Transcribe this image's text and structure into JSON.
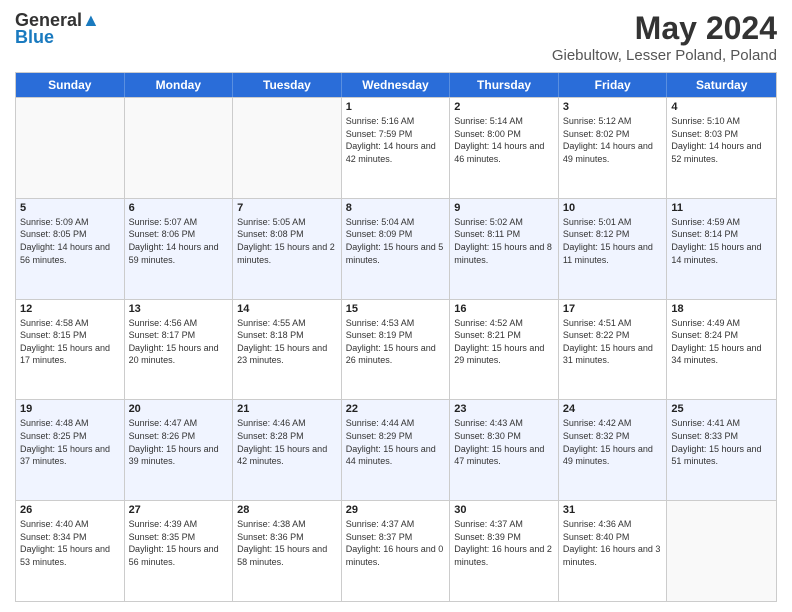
{
  "header": {
    "logo_general": "General",
    "logo_blue": "Blue",
    "title": "May 2024",
    "subtitle": "Giebultow, Lesser Poland, Poland"
  },
  "days_of_week": [
    "Sunday",
    "Monday",
    "Tuesday",
    "Wednesday",
    "Thursday",
    "Friday",
    "Saturday"
  ],
  "weeks": [
    [
      {
        "day": "",
        "sunrise": "",
        "sunset": "",
        "daylight": ""
      },
      {
        "day": "",
        "sunrise": "",
        "sunset": "",
        "daylight": ""
      },
      {
        "day": "",
        "sunrise": "",
        "sunset": "",
        "daylight": ""
      },
      {
        "day": "1",
        "sunrise": "Sunrise: 5:16 AM",
        "sunset": "Sunset: 7:59 PM",
        "daylight": "Daylight: 14 hours and 42 minutes."
      },
      {
        "day": "2",
        "sunrise": "Sunrise: 5:14 AM",
        "sunset": "Sunset: 8:00 PM",
        "daylight": "Daylight: 14 hours and 46 minutes."
      },
      {
        "day": "3",
        "sunrise": "Sunrise: 5:12 AM",
        "sunset": "Sunset: 8:02 PM",
        "daylight": "Daylight: 14 hours and 49 minutes."
      },
      {
        "day": "4",
        "sunrise": "Sunrise: 5:10 AM",
        "sunset": "Sunset: 8:03 PM",
        "daylight": "Daylight: 14 hours and 52 minutes."
      }
    ],
    [
      {
        "day": "5",
        "sunrise": "Sunrise: 5:09 AM",
        "sunset": "Sunset: 8:05 PM",
        "daylight": "Daylight: 14 hours and 56 minutes."
      },
      {
        "day": "6",
        "sunrise": "Sunrise: 5:07 AM",
        "sunset": "Sunset: 8:06 PM",
        "daylight": "Daylight: 14 hours and 59 minutes."
      },
      {
        "day": "7",
        "sunrise": "Sunrise: 5:05 AM",
        "sunset": "Sunset: 8:08 PM",
        "daylight": "Daylight: 15 hours and 2 minutes."
      },
      {
        "day": "8",
        "sunrise": "Sunrise: 5:04 AM",
        "sunset": "Sunset: 8:09 PM",
        "daylight": "Daylight: 15 hours and 5 minutes."
      },
      {
        "day": "9",
        "sunrise": "Sunrise: 5:02 AM",
        "sunset": "Sunset: 8:11 PM",
        "daylight": "Daylight: 15 hours and 8 minutes."
      },
      {
        "day": "10",
        "sunrise": "Sunrise: 5:01 AM",
        "sunset": "Sunset: 8:12 PM",
        "daylight": "Daylight: 15 hours and 11 minutes."
      },
      {
        "day": "11",
        "sunrise": "Sunrise: 4:59 AM",
        "sunset": "Sunset: 8:14 PM",
        "daylight": "Daylight: 15 hours and 14 minutes."
      }
    ],
    [
      {
        "day": "12",
        "sunrise": "Sunrise: 4:58 AM",
        "sunset": "Sunset: 8:15 PM",
        "daylight": "Daylight: 15 hours and 17 minutes."
      },
      {
        "day": "13",
        "sunrise": "Sunrise: 4:56 AM",
        "sunset": "Sunset: 8:17 PM",
        "daylight": "Daylight: 15 hours and 20 minutes."
      },
      {
        "day": "14",
        "sunrise": "Sunrise: 4:55 AM",
        "sunset": "Sunset: 8:18 PM",
        "daylight": "Daylight: 15 hours and 23 minutes."
      },
      {
        "day": "15",
        "sunrise": "Sunrise: 4:53 AM",
        "sunset": "Sunset: 8:19 PM",
        "daylight": "Daylight: 15 hours and 26 minutes."
      },
      {
        "day": "16",
        "sunrise": "Sunrise: 4:52 AM",
        "sunset": "Sunset: 8:21 PM",
        "daylight": "Daylight: 15 hours and 29 minutes."
      },
      {
        "day": "17",
        "sunrise": "Sunrise: 4:51 AM",
        "sunset": "Sunset: 8:22 PM",
        "daylight": "Daylight: 15 hours and 31 minutes."
      },
      {
        "day": "18",
        "sunrise": "Sunrise: 4:49 AM",
        "sunset": "Sunset: 8:24 PM",
        "daylight": "Daylight: 15 hours and 34 minutes."
      }
    ],
    [
      {
        "day": "19",
        "sunrise": "Sunrise: 4:48 AM",
        "sunset": "Sunset: 8:25 PM",
        "daylight": "Daylight: 15 hours and 37 minutes."
      },
      {
        "day": "20",
        "sunrise": "Sunrise: 4:47 AM",
        "sunset": "Sunset: 8:26 PM",
        "daylight": "Daylight: 15 hours and 39 minutes."
      },
      {
        "day": "21",
        "sunrise": "Sunrise: 4:46 AM",
        "sunset": "Sunset: 8:28 PM",
        "daylight": "Daylight: 15 hours and 42 minutes."
      },
      {
        "day": "22",
        "sunrise": "Sunrise: 4:44 AM",
        "sunset": "Sunset: 8:29 PM",
        "daylight": "Daylight: 15 hours and 44 minutes."
      },
      {
        "day": "23",
        "sunrise": "Sunrise: 4:43 AM",
        "sunset": "Sunset: 8:30 PM",
        "daylight": "Daylight: 15 hours and 47 minutes."
      },
      {
        "day": "24",
        "sunrise": "Sunrise: 4:42 AM",
        "sunset": "Sunset: 8:32 PM",
        "daylight": "Daylight: 15 hours and 49 minutes."
      },
      {
        "day": "25",
        "sunrise": "Sunrise: 4:41 AM",
        "sunset": "Sunset: 8:33 PM",
        "daylight": "Daylight: 15 hours and 51 minutes."
      }
    ],
    [
      {
        "day": "26",
        "sunrise": "Sunrise: 4:40 AM",
        "sunset": "Sunset: 8:34 PM",
        "daylight": "Daylight: 15 hours and 53 minutes."
      },
      {
        "day": "27",
        "sunrise": "Sunrise: 4:39 AM",
        "sunset": "Sunset: 8:35 PM",
        "daylight": "Daylight: 15 hours and 56 minutes."
      },
      {
        "day": "28",
        "sunrise": "Sunrise: 4:38 AM",
        "sunset": "Sunset: 8:36 PM",
        "daylight": "Daylight: 15 hours and 58 minutes."
      },
      {
        "day": "29",
        "sunrise": "Sunrise: 4:37 AM",
        "sunset": "Sunset: 8:37 PM",
        "daylight": "Daylight: 16 hours and 0 minutes."
      },
      {
        "day": "30",
        "sunrise": "Sunrise: 4:37 AM",
        "sunset": "Sunset: 8:39 PM",
        "daylight": "Daylight: 16 hours and 2 minutes."
      },
      {
        "day": "31",
        "sunrise": "Sunrise: 4:36 AM",
        "sunset": "Sunset: 8:40 PM",
        "daylight": "Daylight: 16 hours and 3 minutes."
      },
      {
        "day": "",
        "sunrise": "",
        "sunset": "",
        "daylight": ""
      }
    ]
  ]
}
